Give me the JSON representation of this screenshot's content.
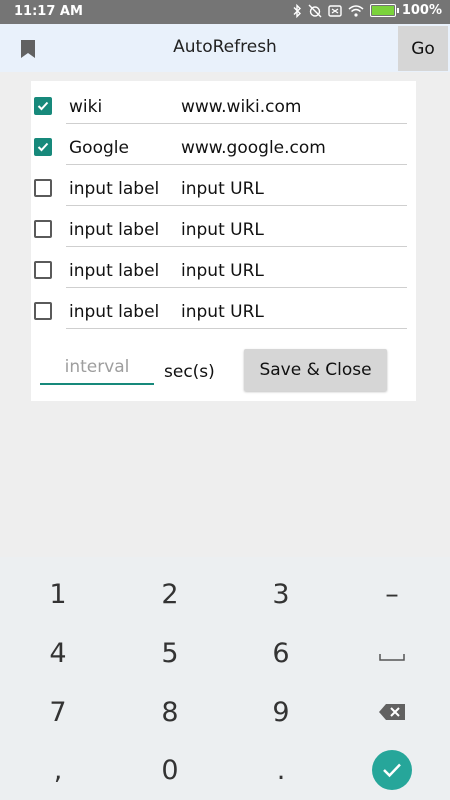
{
  "status_bar": {
    "time": "11:17 AM",
    "battery": "100%",
    "icons": [
      "bluetooth-icon",
      "alarm-off-icon",
      "nfc-icon",
      "wifi-icon",
      "battery-icon"
    ]
  },
  "app_bar": {
    "title": "AutoRefresh",
    "go_label": "Go",
    "left_icon": "bookmark-icon"
  },
  "form": {
    "rows": [
      {
        "checked": true,
        "label": "wiki",
        "url": "www.wiki.com"
      },
      {
        "checked": true,
        "label": "Google",
        "url": "www.google.com"
      },
      {
        "checked": false,
        "label": "input label",
        "url": "input URL"
      },
      {
        "checked": false,
        "label": "input label",
        "url": "input URL"
      },
      {
        "checked": false,
        "label": "input label",
        "url": "input URL"
      },
      {
        "checked": false,
        "label": "input label",
        "url": "input URL"
      }
    ],
    "interval_placeholder": "interval",
    "unit_label": "sec(s)",
    "save_label": "Save & Close"
  },
  "keyboard": {
    "keys": [
      [
        "1",
        "2",
        "3",
        "–"
      ],
      [
        "4",
        "5",
        "6",
        "space"
      ],
      [
        "7",
        "8",
        "9",
        "backspace"
      ],
      [
        ",",
        "0",
        ".",
        "done"
      ]
    ]
  },
  "colors": {
    "accent": "#17897b",
    "done_button": "#26a69a",
    "app_bar_bg": "#e9f1fb",
    "status_bar_bg": "#757575"
  }
}
